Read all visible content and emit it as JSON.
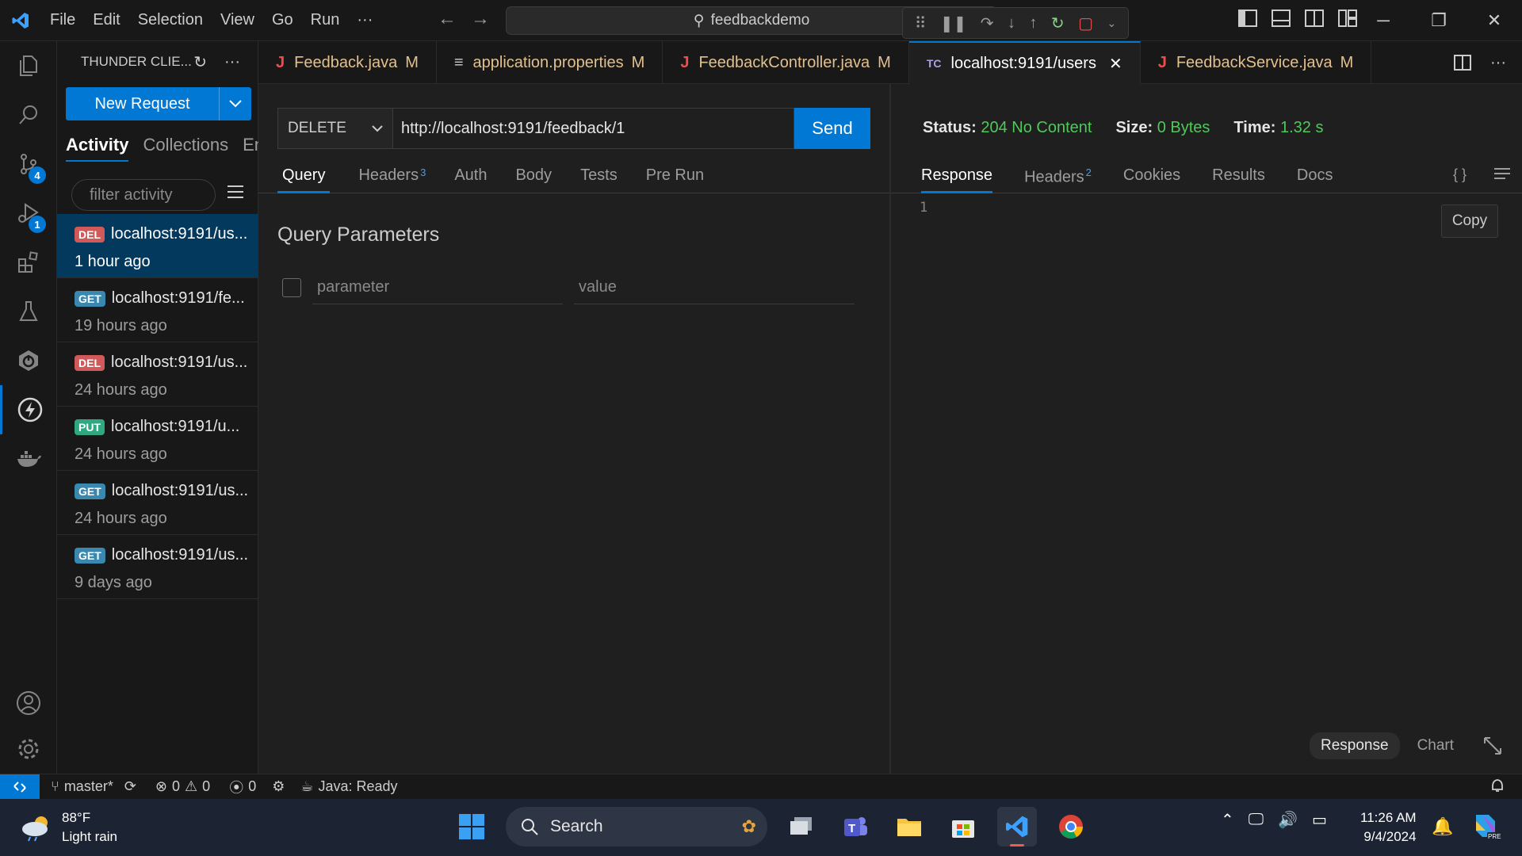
{
  "titlebar": {
    "menu": [
      "File",
      "Edit",
      "Selection",
      "View",
      "Go",
      "Run",
      "···"
    ],
    "search": "feedbackdemo"
  },
  "activitybar": {
    "source_control_badge": "4",
    "run_debug_badge": "1"
  },
  "sidebar": {
    "title": "THUNDER CLIE...",
    "new_request": "New Request",
    "tabs": [
      "Activity",
      "Collections",
      "Env"
    ],
    "filter_placeholder": "filter activity",
    "activity": [
      {
        "method": "DEL",
        "url": "localhost:9191/us...",
        "time": "1 hour ago"
      },
      {
        "method": "GET",
        "url": "localhost:9191/fe...",
        "time": "19 hours ago"
      },
      {
        "method": "DEL",
        "url": "localhost:9191/us...",
        "time": "24 hours ago"
      },
      {
        "method": "PUT",
        "url": "localhost:9191/u...",
        "time": "24 hours ago"
      },
      {
        "method": "GET",
        "url": "localhost:9191/us...",
        "time": "24 hours ago"
      },
      {
        "method": "GET",
        "url": "localhost:9191/us...",
        "time": "9 days ago"
      }
    ]
  },
  "tabs": [
    {
      "icon": "J",
      "label": "Feedback.java",
      "mod": "M"
    },
    {
      "icon": "≡",
      "label": "application.properties",
      "mod": "M"
    },
    {
      "icon": "J",
      "label": "FeedbackController.java",
      "mod": "M"
    },
    {
      "icon": "TC",
      "label": "localhost:9191/users",
      "mod": ""
    },
    {
      "icon": "J",
      "label": "FeedbackService.java",
      "mod": "M"
    }
  ],
  "request": {
    "method": "DELETE",
    "url": "http://localhost:9191/feedback/1",
    "send": "Send",
    "tabs": {
      "query": "Query",
      "headers": "Headers",
      "headers_count": "3",
      "auth": "Auth",
      "body": "Body",
      "tests": "Tests",
      "prerun": "Pre Run"
    },
    "query_title": "Query Parameters",
    "param_placeholder": "parameter",
    "value_placeholder": "value"
  },
  "response": {
    "status_label": "Status:",
    "status": "204 No Content",
    "size_label": "Size:",
    "size": "0 Bytes",
    "time_label": "Time:",
    "time": "1.32 s",
    "tabs": {
      "response": "Response",
      "headers": "Headers",
      "headers_count": "2",
      "cookies": "Cookies",
      "results": "Results",
      "docs": "Docs"
    },
    "line": "1",
    "copy": "Copy",
    "footer_response": "Response",
    "footer_chart": "Chart"
  },
  "statusbar": {
    "branch": "master*",
    "errors": "0",
    "warnings": "0",
    "ports": "0",
    "java": "Java: Ready"
  },
  "taskbar": {
    "temp": "88°F",
    "weather": "Light rain",
    "search": "Search",
    "time": "11:26 AM",
    "date": "9/4/2024"
  },
  "colors": {
    "accent": "#0078d4",
    "success": "#4ec95a",
    "modified": "#e2c08d",
    "java_icon": "#f14c4c"
  }
}
